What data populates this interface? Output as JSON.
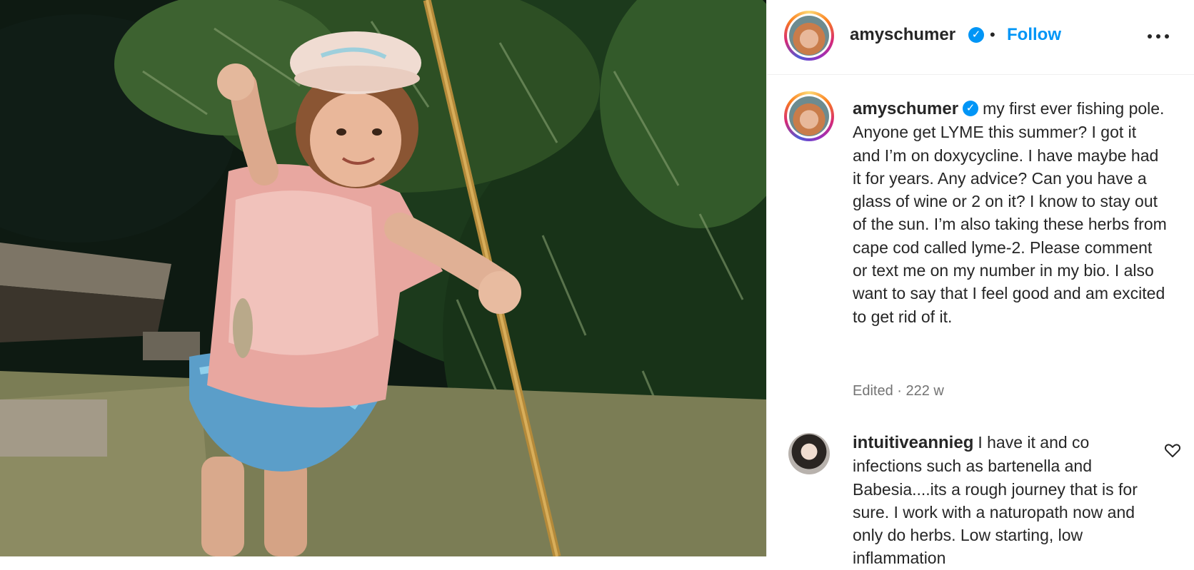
{
  "post": {
    "author": {
      "username": "amyschumer",
      "verified": true,
      "follow_label": "Follow",
      "separator": "•"
    },
    "more_icon": "more-horizontal-icon",
    "caption": {
      "username": "amyschumer",
      "text": "my first ever fishing pole. Anyone get LYME this summer? I got it and I’m on doxycycline. I have maybe had it for years. Any advice? Can you have a glass of wine or 2 on it? I know to stay out of the sun. I’m also taking these herbs from cape cod called lyme-2. Please comment or text me on my number in my bio. I also want to say that I feel good and am excited to get rid of it."
    },
    "meta": "Edited · 222 w",
    "comments": [
      {
        "username": "intuitiveannieg",
        "text": "I have it and co infections such as bartenella and Babesia....its a rough journey that is for sure. I work with a naturopath now and only do herbs. Low starting, low inflammation"
      }
    ]
  },
  "colors": {
    "accent": "#0095f6",
    "text": "#262626",
    "muted": "#737373",
    "divider": "#efefef"
  }
}
